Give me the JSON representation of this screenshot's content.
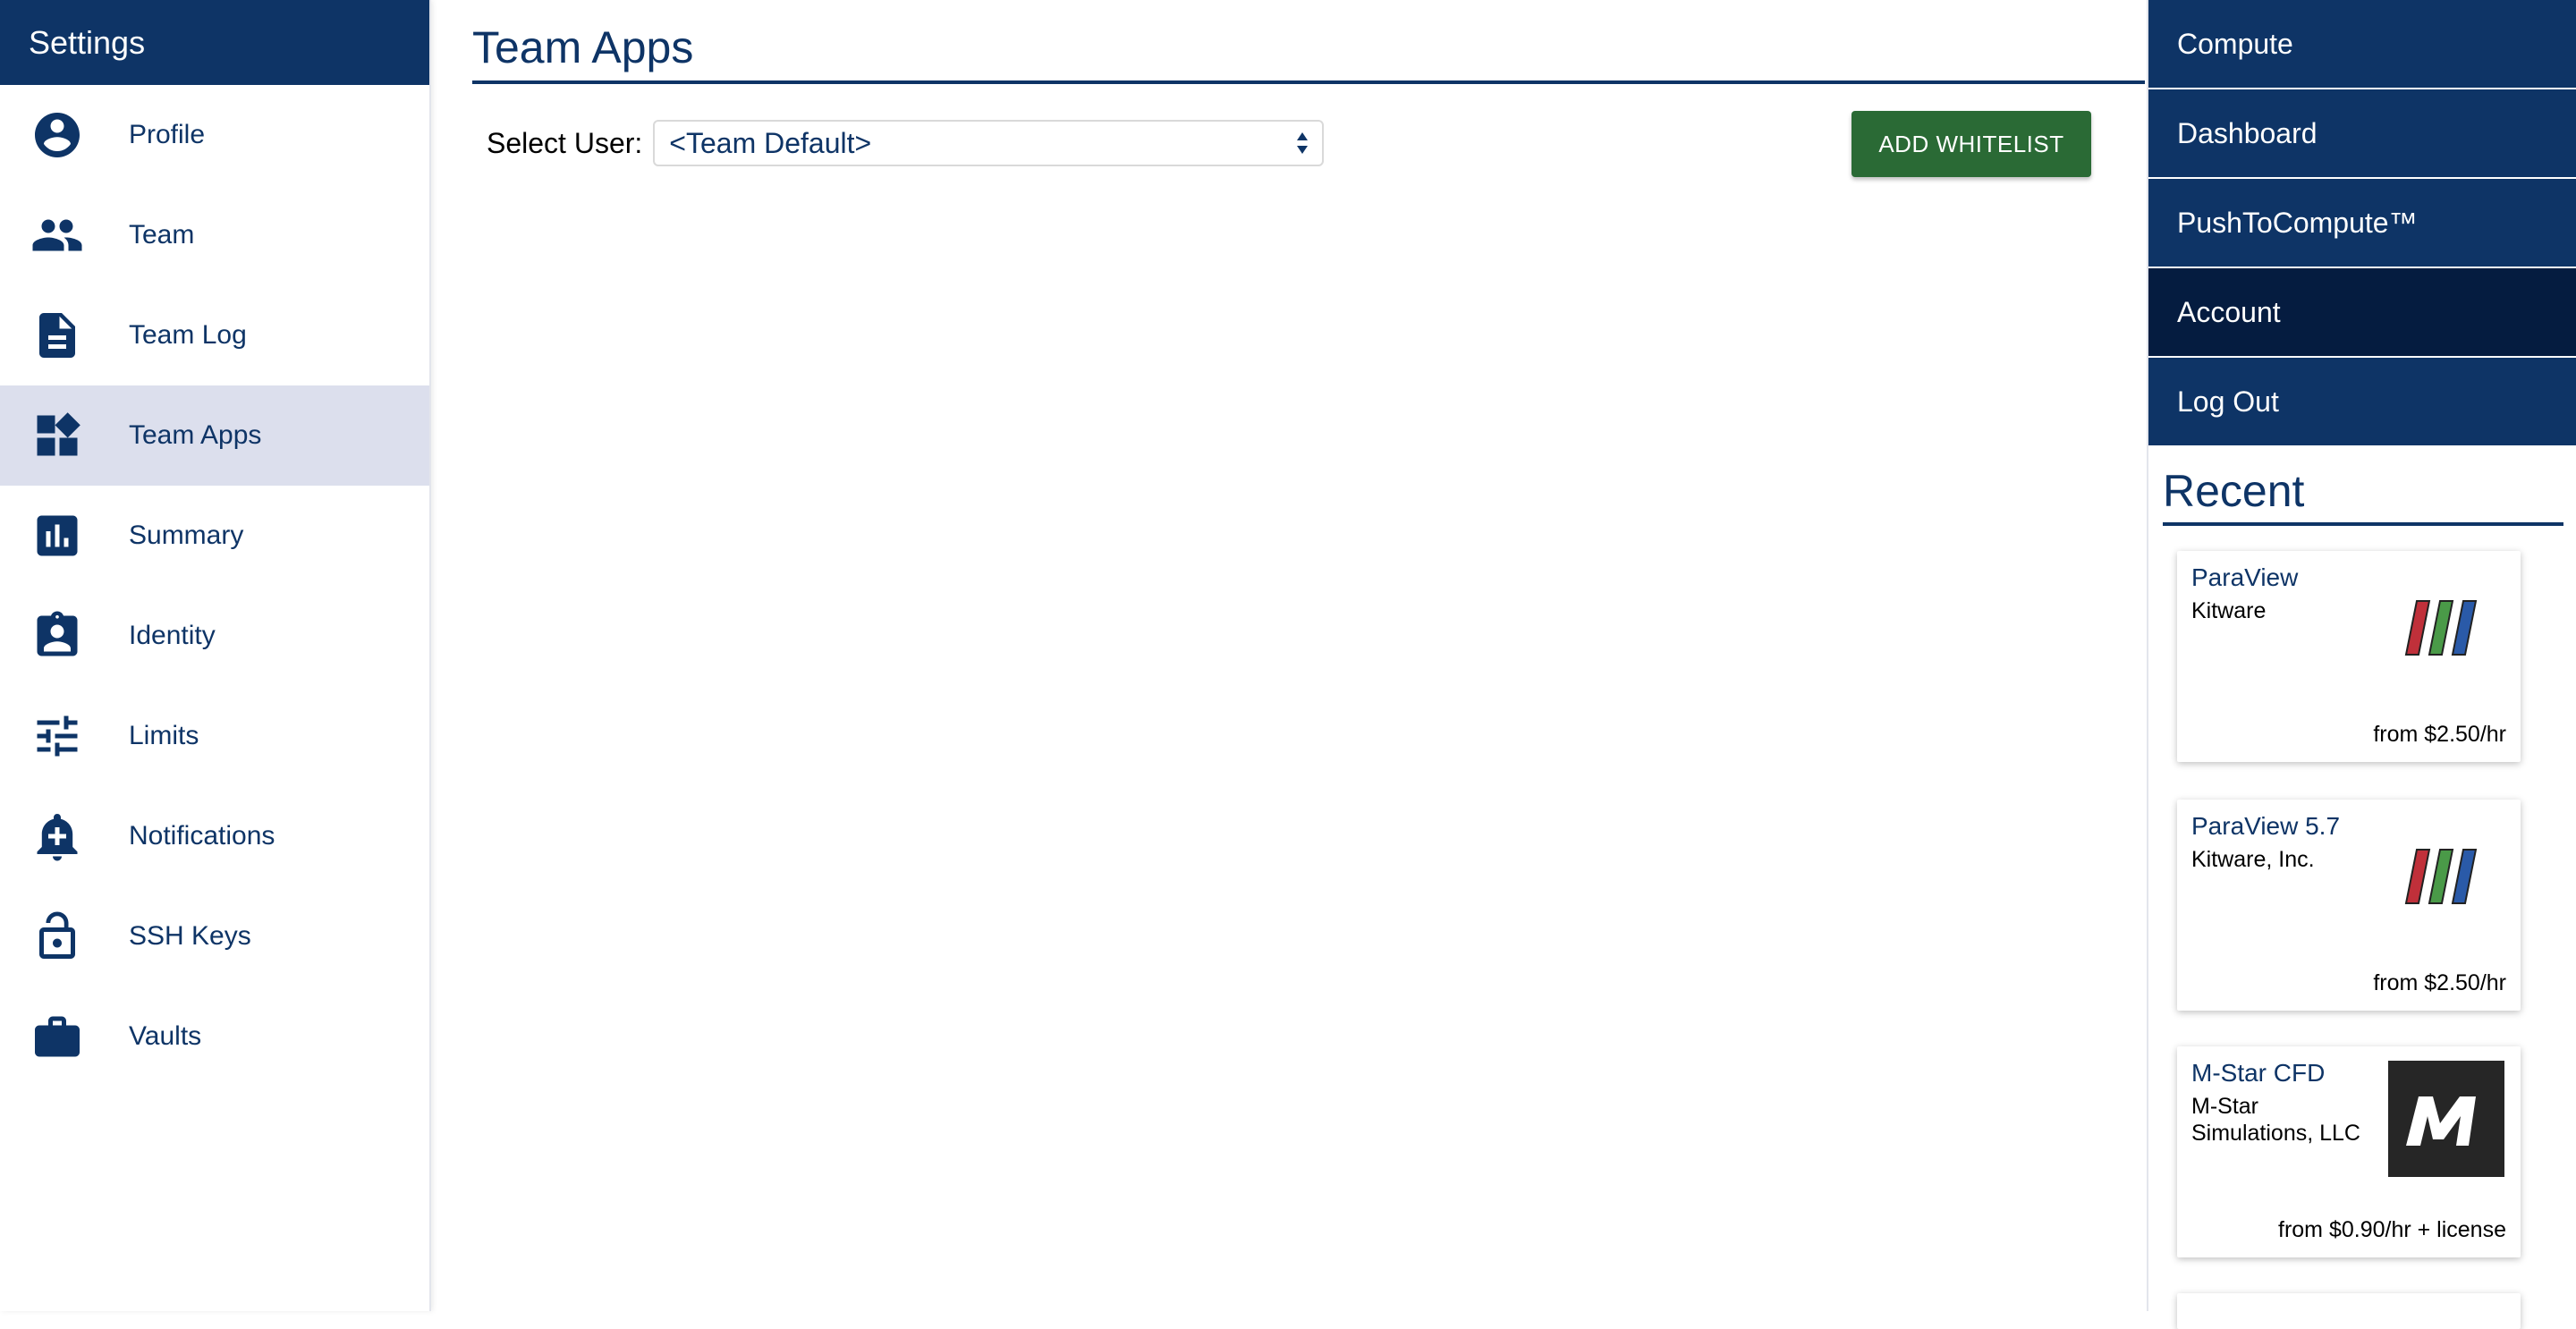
{
  "sidebar": {
    "title": "Settings",
    "items": [
      {
        "label": "Profile",
        "icon": "account-circle-icon"
      },
      {
        "label": "Team",
        "icon": "people-icon"
      },
      {
        "label": "Team Log",
        "icon": "document-icon"
      },
      {
        "label": "Team Apps",
        "icon": "widgets-icon",
        "active": true
      },
      {
        "label": "Summary",
        "icon": "bar-chart-icon"
      },
      {
        "label": "Identity",
        "icon": "badge-icon"
      },
      {
        "label": "Limits",
        "icon": "sliders-icon"
      },
      {
        "label": "Notifications",
        "icon": "bell-plus-icon"
      },
      {
        "label": "SSH Keys",
        "icon": "lock-open-icon"
      },
      {
        "label": "Vaults",
        "icon": "briefcase-icon"
      }
    ]
  },
  "main": {
    "title": "Team Apps",
    "select_label": "Select User:",
    "select_value": "<Team Default>",
    "add_button_label": "ADD WHITELIST"
  },
  "nav": {
    "items": [
      {
        "label": "Compute"
      },
      {
        "label": "Dashboard"
      },
      {
        "label": "PushToCompute™"
      },
      {
        "label": "Account",
        "active": true
      },
      {
        "label": "Log Out"
      }
    ]
  },
  "recent": {
    "title": "Recent",
    "cards": [
      {
        "name": "ParaView",
        "vendor": "Kitware",
        "price": "from $2.50/hr",
        "logo": "paraview-logo"
      },
      {
        "name": "ParaView 5.7",
        "vendor": "Kitware, Inc.",
        "price": "from $2.50/hr",
        "logo": "paraview-logo"
      },
      {
        "name": "M-Star CFD",
        "vendor": "M-Star Simulations, LLC",
        "price": "from $0.90/hr + license",
        "logo": "mstar-logo"
      }
    ]
  },
  "colors": {
    "primary": "#0e3466",
    "active_nav": "#051c40",
    "active_sidebar": "#dcdfed",
    "button_green": "#2a6a35"
  }
}
